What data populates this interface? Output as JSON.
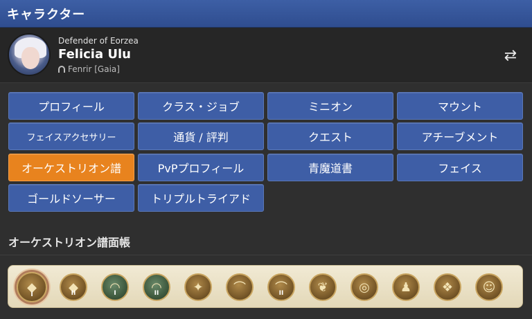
{
  "window": {
    "title": "キャラクター"
  },
  "profile": {
    "title": "Defender of Eorzea",
    "name": "Felicia Ulu",
    "world": "Fenrir [Gaia]"
  },
  "menu": {
    "items": [
      "プロフィール",
      "クラス・ジョブ",
      "ミニオン",
      "マウント",
      "フェイスアクセサリー",
      "通貨 / 評判",
      "クエスト",
      "アチーブメント",
      "オーケストリオン譜",
      "PvPプロフィール",
      "青魔道書",
      "フェイス",
      "ゴールドソーサー",
      "トリプルトライアド"
    ],
    "active_index": 8,
    "active_color": "#e8831e",
    "button_color": "#3e5ea6"
  },
  "orchestrion": {
    "section_title": "オーケストリオン譜面帳",
    "medals": [
      {
        "icon": "crystal-medal-icon",
        "numeral": "I"
      },
      {
        "icon": "crystal-medal-icon",
        "numeral": "II"
      },
      {
        "icon": "cave-medal-icon",
        "numeral": "I"
      },
      {
        "icon": "cave-medal-icon",
        "numeral": "II"
      },
      {
        "icon": "emblem-medal-icon",
        "numeral": ""
      },
      {
        "icon": "arch-medal-icon",
        "numeral": ""
      },
      {
        "icon": "arch-medal-icon",
        "numeral": "II"
      },
      {
        "icon": "bird-medal-icon",
        "numeral": ""
      },
      {
        "icon": "ring-medal-icon",
        "numeral": ""
      },
      {
        "icon": "bag-medal-icon",
        "numeral": ""
      },
      {
        "icon": "feather-medal-icon",
        "numeral": ""
      },
      {
        "icon": "cat-medal-icon",
        "numeral": ""
      }
    ]
  }
}
